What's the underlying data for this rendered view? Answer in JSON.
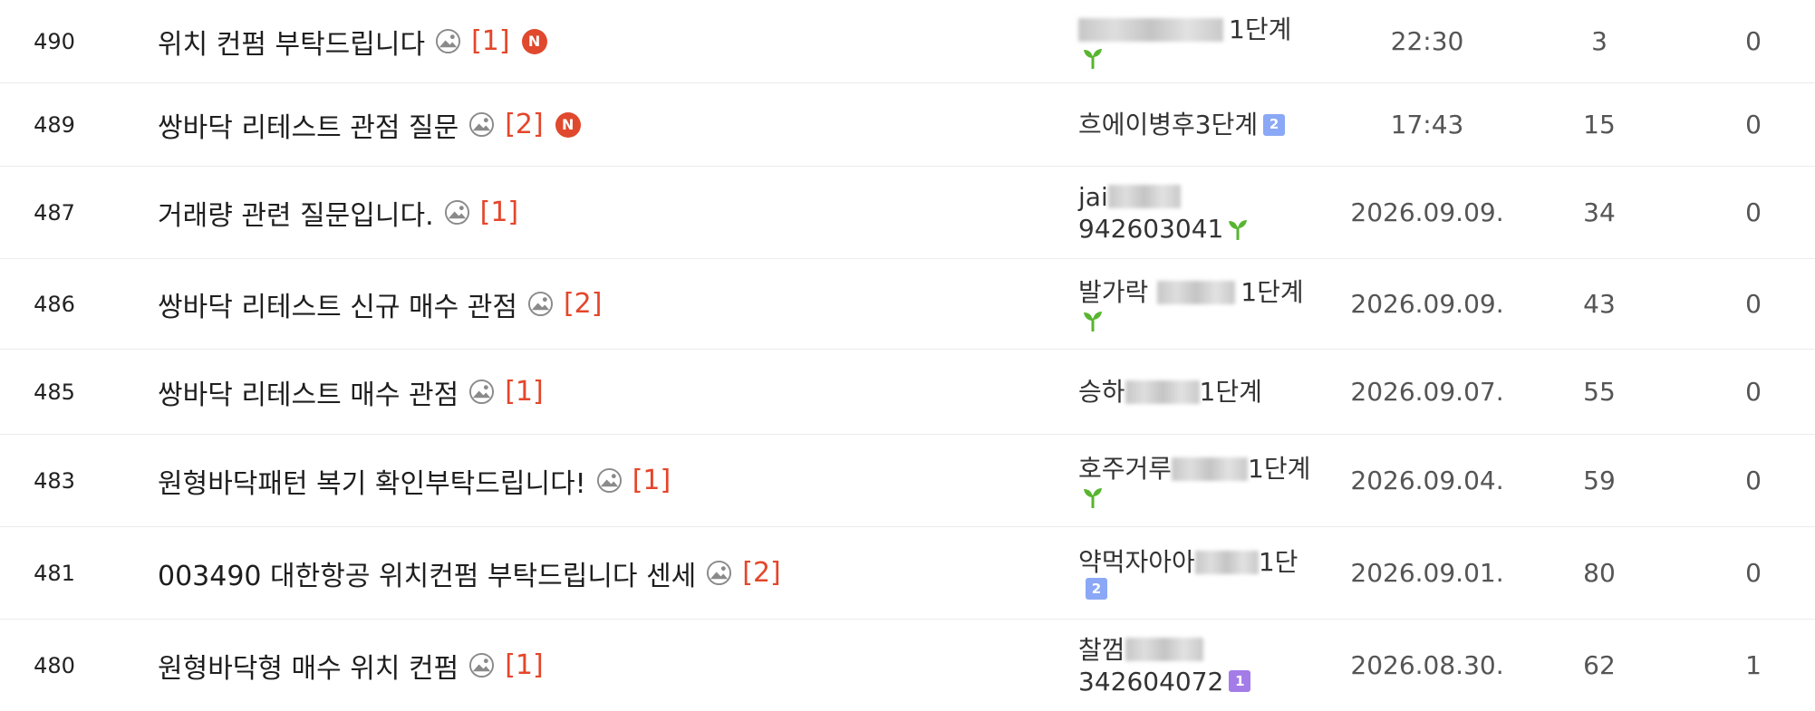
{
  "colors": {
    "comment_count": "#e4462b",
    "new_badge": "#e0492d",
    "sprout": "#57b52f",
    "grade_2": "#8aa8f5",
    "grade_1": "#a47ce8"
  },
  "icons": {
    "image_attachment": "image-icon",
    "new": "new-badge",
    "beginner": "sprout-icon"
  },
  "rows": [
    {
      "num": "490",
      "title": "위치 컨펌 부탁드립니다",
      "comments": "[1]",
      "new_badge": "N",
      "author_prefix": "",
      "author_suffix": "1단계",
      "author_line2": "",
      "grade": "",
      "date": "22:30",
      "views": "3",
      "likes": "0"
    },
    {
      "num": "489",
      "title": "쌍바닥 리테스트 관점 질문",
      "comments": "[2]",
      "new_badge": "N",
      "author_prefix": "흐에이병후3단계",
      "author_suffix": "",
      "author_line2": "",
      "grade": "2",
      "date": "17:43",
      "views": "15",
      "likes": "0"
    },
    {
      "num": "487",
      "title": "거래량 관련 질문입니다.",
      "comments": "[1]",
      "new_badge": "",
      "author_prefix": "jai",
      "author_suffix": "",
      "author_line2": "942603041",
      "grade": "",
      "date": "2026.09.09.",
      "views": "34",
      "likes": "0"
    },
    {
      "num": "486",
      "title": "쌍바닥 리테스트 신규 매수 관점",
      "comments": "[2]",
      "new_badge": "",
      "author_prefix": "발가락",
      "author_suffix": "1단계",
      "author_line2": "",
      "grade": "",
      "date": "2026.09.09.",
      "views": "43",
      "likes": "0"
    },
    {
      "num": "485",
      "title": "쌍바닥 리테스트 매수 관점",
      "comments": "[1]",
      "new_badge": "",
      "author_prefix": "승하",
      "author_suffix": "1단계",
      "author_line2": "",
      "grade": "",
      "date": "2026.09.07.",
      "views": "55",
      "likes": "0"
    },
    {
      "num": "483",
      "title": "원형바닥패턴 복기 확인부탁드립니다!",
      "comments": "[1]",
      "new_badge": "",
      "author_prefix": "호주거루",
      "author_suffix": "1단계",
      "author_line2": "",
      "grade": "",
      "date": "2026.09.04.",
      "views": "59",
      "likes": "0"
    },
    {
      "num": "481",
      "title": "003490 대한항공 위치컨펌 부탁드립니다 센세",
      "comments": "[2]",
      "new_badge": "",
      "author_prefix": "약먹자아아",
      "author_suffix": "1단",
      "author_line2": "",
      "grade": "2",
      "date": "2026.09.01.",
      "views": "80",
      "likes": "0"
    },
    {
      "num": "480",
      "title": "원형바닥형 매수 위치 컨펌",
      "comments": "[1]",
      "new_badge": "",
      "author_prefix": "찰껌",
      "author_suffix": "",
      "author_line2": "342604072",
      "grade": "1",
      "date": "2026.08.30.",
      "views": "62",
      "likes": "1"
    }
  ]
}
